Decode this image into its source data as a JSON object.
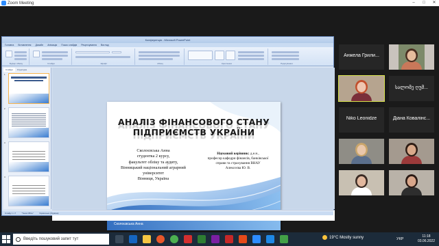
{
  "zoom": {
    "window_title": "Zoom Meeting",
    "controls": [
      "–",
      "□",
      "✕"
    ]
  },
  "powerpoint": {
    "window_title": "Конференція - Microsoft PowerPoint",
    "tabs": [
      "Головна",
      "Вставлення",
      "Дизайн",
      "Анімація",
      "Показ слайдів",
      "Рецензування",
      "Вигляд"
    ],
    "ribbon_groups": [
      "Буфер обміну",
      "Слайди",
      "Шрифт",
      "Абзац",
      "Креслення",
      "Редагування"
    ],
    "outline_tabs": [
      "Слайди",
      "Структура"
    ],
    "slide_numbers": [
      "1",
      "2",
      "3",
      "4"
    ],
    "notes_placeholder": "Замітки до слайду",
    "status": [
      "Слайд 1 з 7",
      "\"Тема Office\"",
      "Українська (Україна)"
    ]
  },
  "slide": {
    "title_line1": "АНАЛІЗ ФІНАНСОВОГО СТАНУ",
    "title_line2": "ПІДПРИЄМСТВ УКРАЇНИ",
    "student_lines": [
      "Сколоєвська Анна",
      "студентка 2 курсу,",
      "факультет обліку та аудиту,",
      "Вінницький національний аграрний",
      "університет",
      "Вінниця, Україна"
    ],
    "supervisor_label": "Науковий керівник:",
    "supervisor_lines": [
      "д.е.н.,",
      "професор кафедри фінансів, банківської",
      "справи та страхування ВНАУ",
      "Алексєєва Ю. В."
    ],
    "footer_author": "Сколоєвська Анна"
  },
  "participants": [
    {
      "name": "",
      "kind": "video",
      "hair": "#d9d4cf",
      "skin": "#e4c1a8",
      "shirt": "#3d3d46",
      "bg": "#9aa6b1"
    },
    {
      "name": "",
      "kind": "video",
      "hair": "#5a3a2a",
      "skin": "#e8bea2",
      "shirt": "#2f3552",
      "bg": "#c9c3bd"
    },
    {
      "name": "",
      "kind": "video",
      "speaking": true,
      "hair": "#c2502d",
      "skin": "#efc6b0",
      "shirt": "#7a2f3a",
      "bg": "#b6a48f"
    },
    {
      "name": "სალომე ღუმ...",
      "kind": "name"
    },
    {
      "name": "Niko Leonidze",
      "kind": "name"
    },
    {
      "name": "Діана Ковалінс...",
      "kind": "name"
    },
    {
      "name": "",
      "kind": "video",
      "hair": "#c9a56b",
      "skin": "#e9c7ab",
      "shirt": "#5b6f8c",
      "bg": "#8f8d86"
    },
    {
      "name": "",
      "kind": "video",
      "hair": "#2e1d15",
      "skin": "#d9a98a",
      "shirt": "#9b3a3a",
      "bg": "#a49a8f"
    },
    {
      "name": "",
      "kind": "video",
      "hair": "#3a2b24",
      "skin": "#e2b89e",
      "shirt": "#ffffff",
      "bg": "#c8c0b2"
    },
    {
      "name": "",
      "kind": "video",
      "hair": "#2a1a14",
      "skin": "#d8a68a",
      "shirt": "#2e2e2e",
      "bg": "#b9b2a8"
    },
    {
      "name": "Анжела Грили...",
      "kind": "name"
    },
    {
      "name": "",
      "kind": "video",
      "hair": "#4a2e20",
      "skin": "#e6bc9c",
      "shirt": "#c9785a",
      "bg": "#7d8a6a"
    }
  ],
  "taskbar": {
    "search_placeholder": "Введіть пошуковий запит тут",
    "weather": "19°C  Mostly sunny",
    "language": "УКР",
    "time": "11:18",
    "date": "03.06.2022"
  }
}
